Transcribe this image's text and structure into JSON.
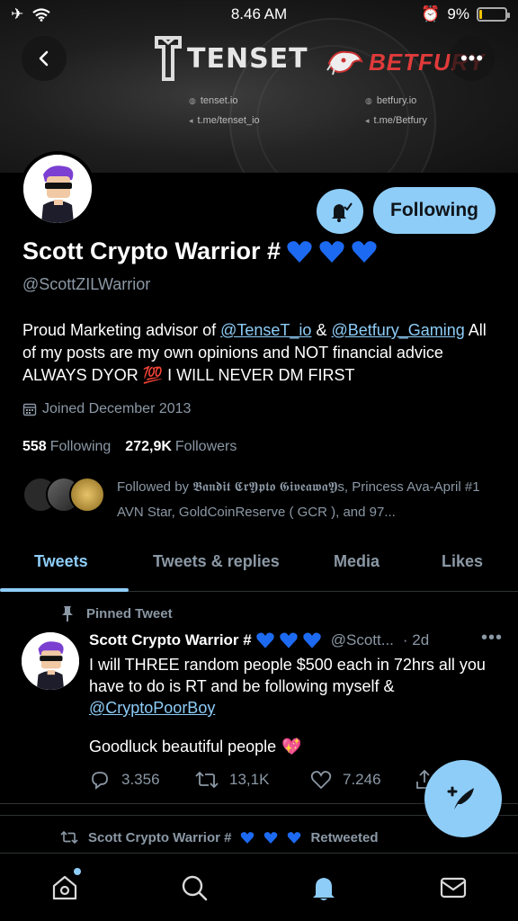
{
  "status_bar": {
    "time": "8.46 AM",
    "battery": "9%"
  },
  "banner": {
    "brand_left": "TENSET",
    "brand_right": "BETFURY",
    "left_links": [
      "tenset.io",
      "t.me/tenset_io"
    ],
    "right_links": [
      "betfury.io",
      "t.me/Betfury"
    ]
  },
  "profile": {
    "name": "Scott Crypto Warrior #",
    "handle": "@ScottZILWarrior",
    "bio_prefix": "Proud Marketing advisor of ",
    "bio_link1": "@TenseT_io",
    "bio_and": " & ",
    "bio_link2": "@Betfury_Gaming",
    "bio_rest": " All of my posts are my own opinions and NOT financial advice ALWAYS DYOR 💯 I WILL NEVER DM FIRST",
    "joined": "Joined December 2013",
    "following_count": "558",
    "following_label": "Following",
    "followers_count": "272,9K",
    "followers_label": "Followers",
    "follow_button": "Following",
    "followed_by": "Followed by 𝕭𝖆𝖓𝖉𝖎𝖙 𝕮𝖗𝖄𝖕𝖙𝖔 𝕲𝖎𝖛𝖊𝖆𝖜𝖆𝖄s, Princess Ava-April #1 AVN Star, GoldCoinReserve ( GCR ), and 97..."
  },
  "tabs": [
    "Tweets",
    "Tweets & replies",
    "Media",
    "Likes"
  ],
  "pinned_tweet": {
    "pinned_label": "Pinned Tweet",
    "author": "Scott Crypto Warrior #",
    "handle": "@Scott...",
    "time": "· 2d",
    "text1": "I will THREE random people $500 each in 72hrs all you have to do is RT and be following myself & ",
    "text_link": "@CryptoPoorBoy",
    "text2": "Goodluck beautiful people",
    "replies": "3.356",
    "retweets": "13,1K",
    "likes": "7.246"
  },
  "next_item": {
    "label": "Scott Crypto Warrior #",
    "suffix": "Retweeted"
  },
  "colors": {
    "accent": "#8ecdf8",
    "heart_blue": "#1d6af2",
    "background": "#000000"
  },
  "icons": [
    "back-icon",
    "more-icon",
    "bell-check-icon",
    "calendar-icon",
    "pin-icon",
    "reply-icon",
    "retweet-icon",
    "like-icon",
    "share-icon",
    "compose-icon",
    "home-icon",
    "search-icon",
    "notifications-icon",
    "messages-icon"
  ]
}
